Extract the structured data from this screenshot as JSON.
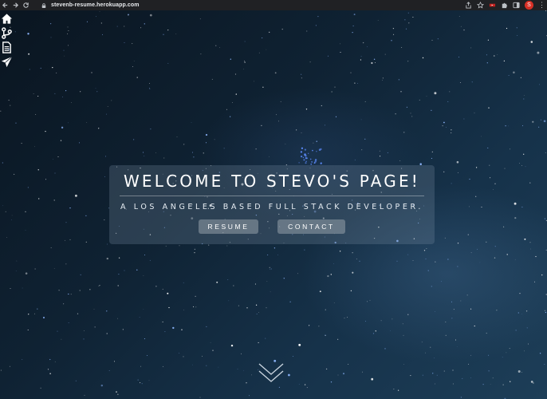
{
  "browser": {
    "url": "stevenb-resume.herokuapp.com",
    "profile_initial": "S",
    "menu_glyph": "⋮"
  },
  "sidebar": {
    "items": [
      {
        "icon": "home-icon"
      },
      {
        "icon": "git-branch-icon"
      },
      {
        "icon": "document-icon"
      },
      {
        "icon": "paper-plane-icon"
      }
    ]
  },
  "hero": {
    "title": "WELCOME TO STEVO'S PAGE!",
    "subtitle": "A LOS ANGELES BASED FULL STACK DEVELOPER.",
    "buttons": {
      "resume": "RESUME",
      "contact": "CONTACT"
    }
  },
  "colors": {
    "chrome_bg": "#202124",
    "avatar_bg": "#d93025",
    "sky_dark": "#0a1520",
    "sky_light": "#1d3e58",
    "hero_panel": "rgba(120,140,160,0.28)",
    "button_bg": "rgba(150,160,170,0.55)"
  }
}
